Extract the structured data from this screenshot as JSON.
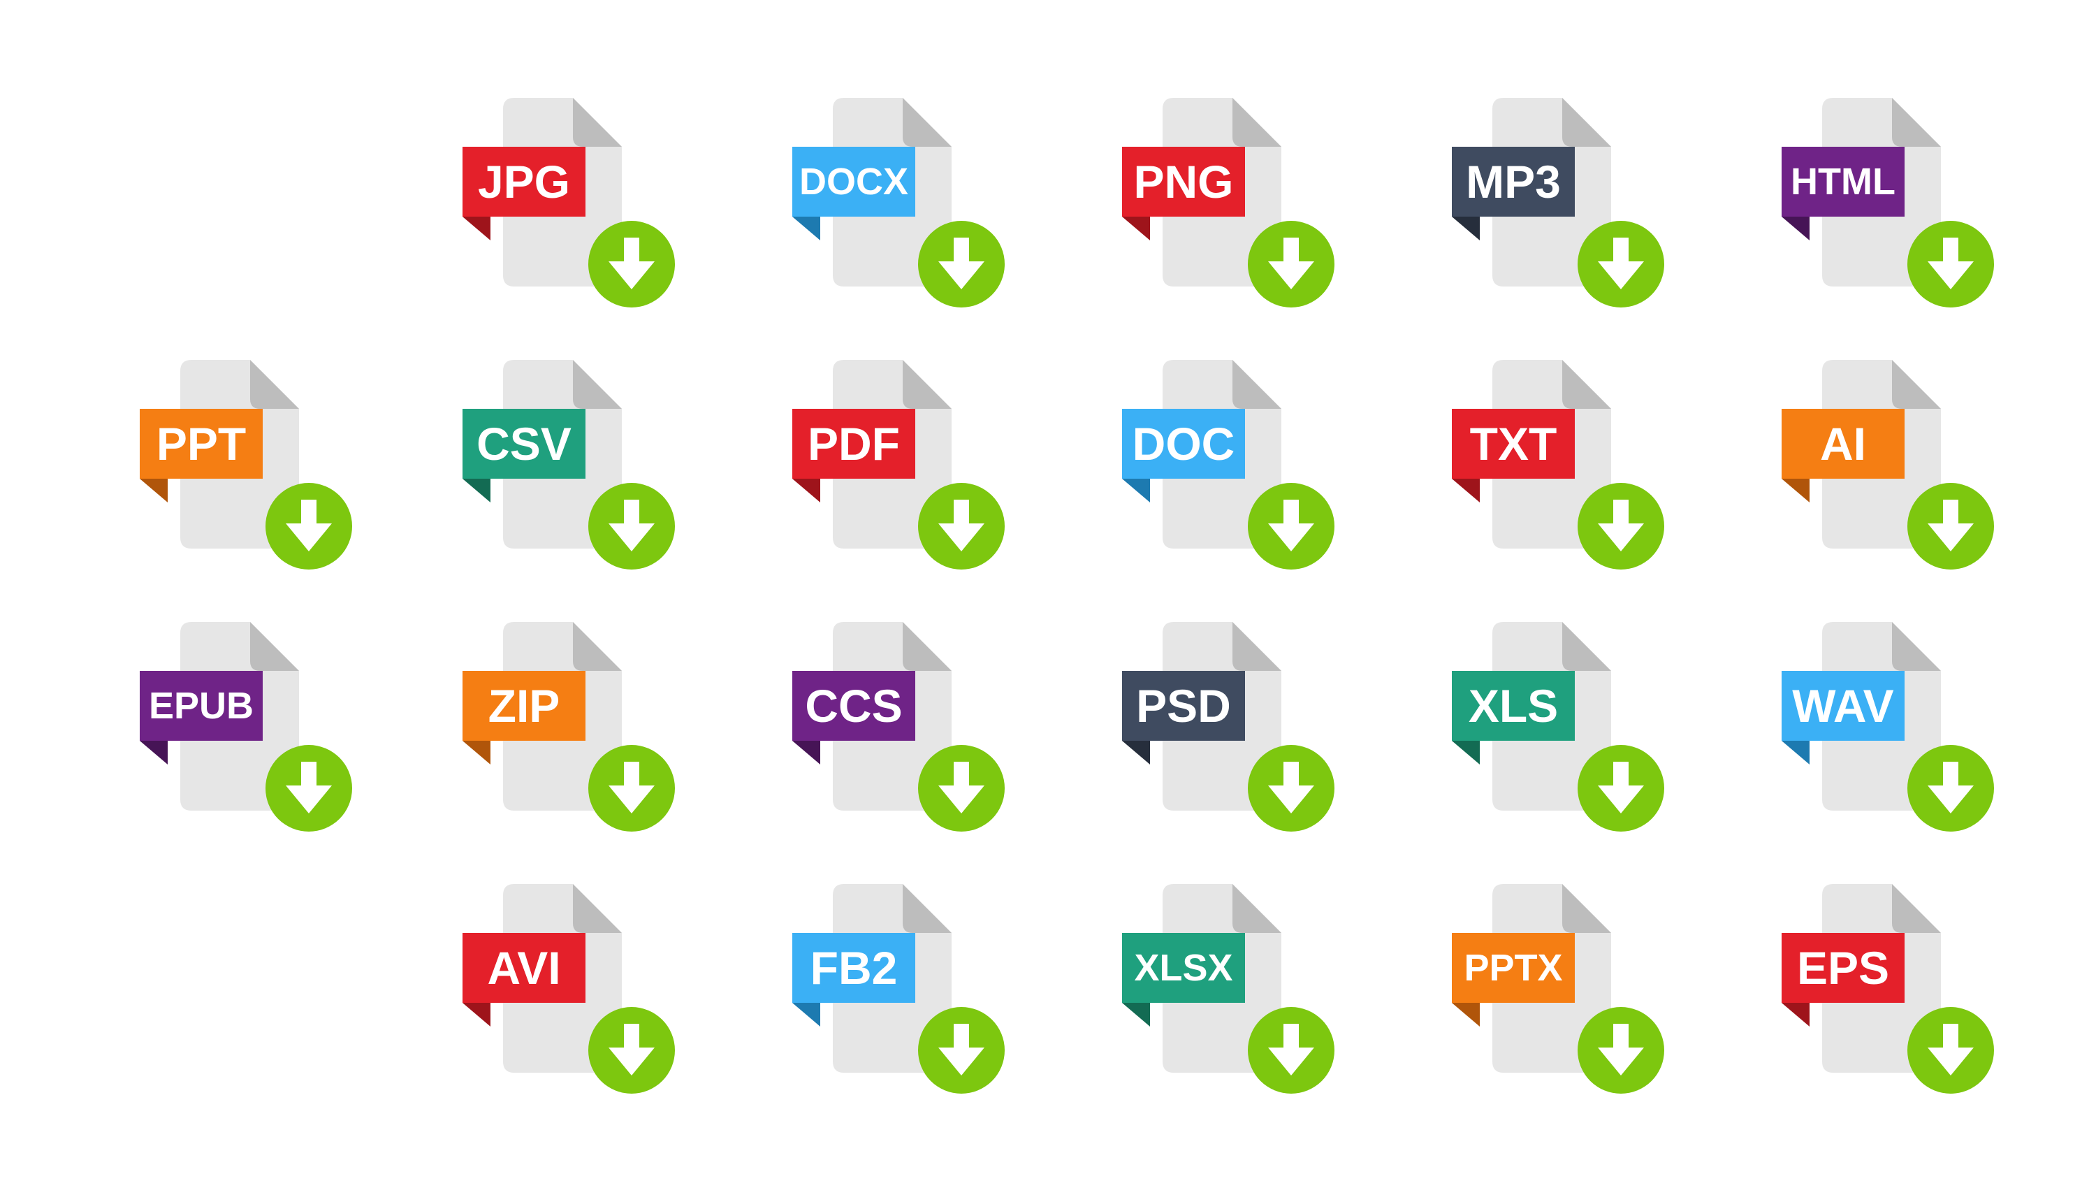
{
  "colors": {
    "page_background": "#ffffff",
    "file_body": "#e6e6e6",
    "file_fold": "#bdbdbd",
    "download_badge": "#7dc70f",
    "download_arrow": "#ffffff",
    "label_text": "#ffffff"
  },
  "icons": [
    {
      "label": "JPG",
      "color": "#e4202a",
      "shade": "#9e141b"
    },
    {
      "label": "DOCX",
      "color": "#3bb0f5",
      "shade": "#1d7ab0"
    },
    {
      "label": "PNG",
      "color": "#e4202a",
      "shade": "#9e141b"
    },
    {
      "label": "MP3",
      "color": "#3f4b60",
      "shade": "#262e3c"
    },
    {
      "label": "HTML",
      "color": "#6f2387",
      "shade": "#461456"
    },
    {
      "label": "PPT",
      "color": "#f57e13",
      "shade": "#b0550a"
    },
    {
      "label": "CSV",
      "color": "#1fa07e",
      "shade": "#136b53"
    },
    {
      "label": "PDF",
      "color": "#e4202a",
      "shade": "#9e141b"
    },
    {
      "label": "DOC",
      "color": "#3bb0f5",
      "shade": "#1d7ab0"
    },
    {
      "label": "TXT",
      "color": "#e4202a",
      "shade": "#9e141b"
    },
    {
      "label": "AI",
      "color": "#f57e13",
      "shade": "#b0550a"
    },
    {
      "label": "EPUB",
      "color": "#6f2387",
      "shade": "#461456"
    },
    {
      "label": "ZIP",
      "color": "#f57e13",
      "shade": "#b0550a"
    },
    {
      "label": "CCS",
      "color": "#6f2387",
      "shade": "#461456"
    },
    {
      "label": "PSD",
      "color": "#3f4b60",
      "shade": "#262e3c"
    },
    {
      "label": "XLS",
      "color": "#1fa07e",
      "shade": "#136b53"
    },
    {
      "label": "WAV",
      "color": "#3bb0f5",
      "shade": "#1d7ab0"
    },
    {
      "label": "AVI",
      "color": "#e4202a",
      "shade": "#9e141b"
    },
    {
      "label": "FB2",
      "color": "#3bb0f5",
      "shade": "#1d7ab0"
    },
    {
      "label": "XLSX",
      "color": "#1fa07e",
      "shade": "#136b53"
    },
    {
      "label": "PPTX",
      "color": "#f57e13",
      "shade": "#b0550a"
    },
    {
      "label": "EPS",
      "color": "#e4202a",
      "shade": "#9e141b"
    }
  ]
}
